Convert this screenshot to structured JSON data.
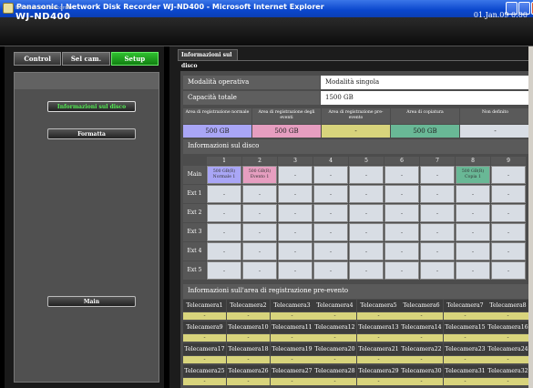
{
  "window": {
    "title": "Panasonic | Network Disk Recorder WJ-ND400 - Microsoft Internet Explorer"
  },
  "header": {
    "subtitle": "Network Disk Recorder",
    "model": "WJ-ND400",
    "date": "01.Jan.09  0:00"
  },
  "tabs": [
    "Control",
    "Sel cam.",
    "Setup"
  ],
  "left_menu": {
    "disk_info": "Informazioni sul disco",
    "format": "Formatta",
    "main": "Main"
  },
  "right_tab": "Informazioni sul disco",
  "rows": [
    {
      "label": "Modalità operativa",
      "value": "Modalità singola"
    },
    {
      "label": "Capacità totale",
      "value": "1500 GB"
    }
  ],
  "areas": [
    {
      "label": "Area di registrazione normale",
      "value": "500 GB",
      "color": "#a9a6f6"
    },
    {
      "label": "Area di registrazione degli eventi",
      "value": "500 GB",
      "color": "#e69ec0"
    },
    {
      "label": "Area di registrazione pre-evento",
      "value": "-",
      "color": "#d8d47c"
    },
    {
      "label": "Area di copiatura",
      "value": "500 GB",
      "color": "#69b896"
    },
    {
      "label": "Non definito",
      "value": "-",
      "color": "#d8dde4"
    }
  ],
  "disk_section": "Informazioni sul disco",
  "disk_cols": [
    "1",
    "2",
    "3",
    "4",
    "5",
    "6",
    "7",
    "8",
    "9"
  ],
  "disk_rows": [
    {
      "label": "Main",
      "cells": [
        "500 GB(R)\nNormale 1",
        "500 GB(R)\nEvento 1",
        "-",
        "-",
        "-",
        "-",
        "-",
        "500 GB(R)\nCopia 1",
        "-"
      ]
    },
    {
      "label": "Ext 1",
      "cells": [
        "-",
        "-",
        "-",
        "-",
        "-",
        "-",
        "-",
        "-",
        "-"
      ]
    },
    {
      "label": "Ext 2",
      "cells": [
        "-",
        "-",
        "-",
        "-",
        "-",
        "-",
        "-",
        "-",
        "-"
      ]
    },
    {
      "label": "Ext 3",
      "cells": [
        "-",
        "-",
        "-",
        "-",
        "-",
        "-",
        "-",
        "-",
        "-"
      ]
    },
    {
      "label": "Ext 4",
      "cells": [
        "-",
        "-",
        "-",
        "-",
        "-",
        "-",
        "-",
        "-",
        "-"
      ]
    },
    {
      "label": "Ext 5",
      "cells": [
        "-",
        "-",
        "-",
        "-",
        "-",
        "-",
        "-",
        "-",
        "-"
      ]
    }
  ],
  "pre_section": "Informazioni sull'area di registrazione pre-evento",
  "cameras": [
    [
      "Telecamera1",
      "Telecamera2",
      "Telecamera3",
      "Telecamera4",
      "Telecamera5",
      "Telecamera6",
      "Telecamera7",
      "Telecamera8"
    ],
    [
      "Telecamera9",
      "Telecamera10",
      "Telecamera11",
      "Telecamera12",
      "Telecamera13",
      "Telecamera14",
      "Telecamera15",
      "Telecamera16"
    ],
    [
      "Telecamera17",
      "Telecamera18",
      "Telecamera19",
      "Telecamera20",
      "Telecamera21",
      "Telecamera22",
      "Telecamera23",
      "Telecamera24"
    ],
    [
      "Telecamera25",
      "Telecamera26",
      "Telecamera27",
      "Telecamera28",
      "Telecamera29",
      "Telecamera30",
      "Telecamera31",
      "Telecamera32"
    ]
  ],
  "camera_value": "-"
}
